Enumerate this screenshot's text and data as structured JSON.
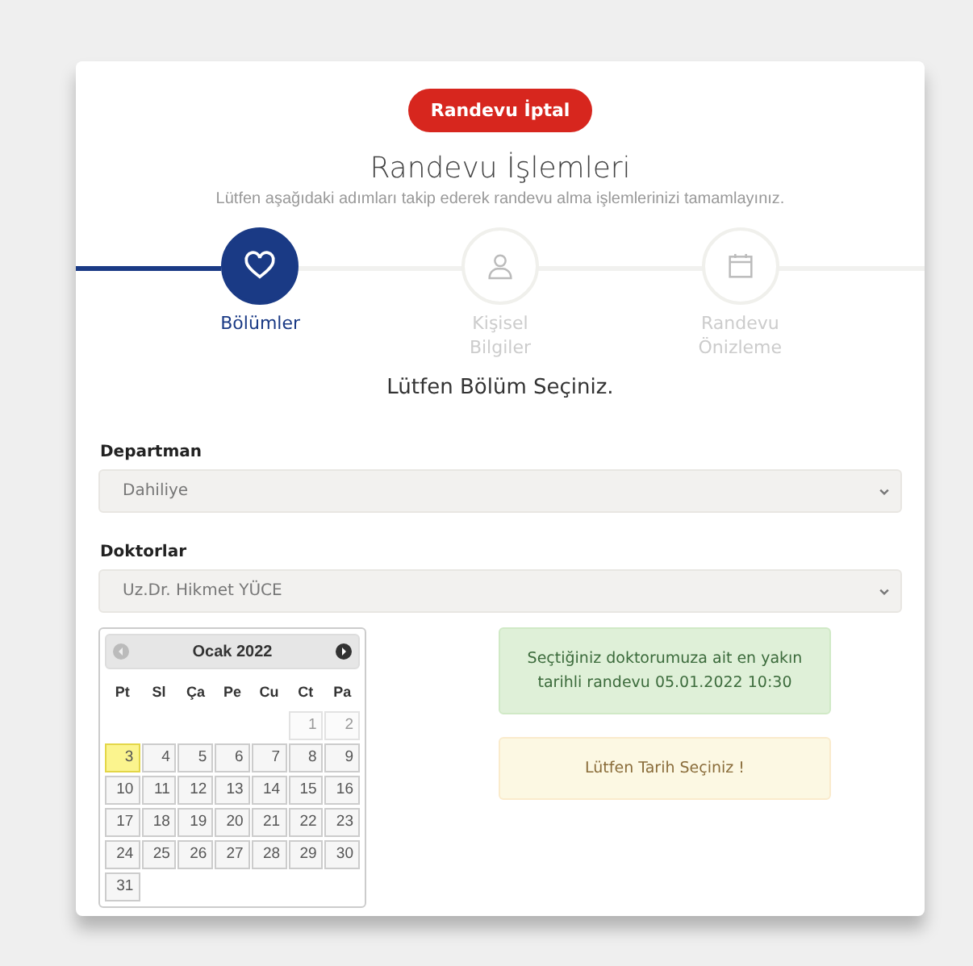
{
  "cancel_button": "Randevu İptal",
  "title": "Randevu İşlemleri",
  "subtitle": "Lütfen aşağıdaki adımları takip ederek randevu alma işlemlerinizi tamamlayınız.",
  "steps": [
    {
      "label": "Bölümler",
      "selected": true
    },
    {
      "label": "Kişisel Bilgiler",
      "selected": false
    },
    {
      "label": "Randevu Önizleme",
      "selected": false
    }
  ],
  "prompt": "Lütfen Bölüm Seçiniz.",
  "fields": [
    {
      "label": "Departman",
      "value": "Dahiliye"
    },
    {
      "label": "Doktorlar",
      "value": "Uz.Dr. Hikmet YÜCE"
    }
  ],
  "calendar": {
    "month": "Ocak 2022",
    "weekdays": [
      "Pt",
      "Sl",
      "Ça",
      "Pe",
      "Cu",
      "Ct",
      "Pa"
    ],
    "weeks": [
      [
        {
          "day": "1",
          "disabled": true,
          "selected": false
        },
        {
          "day": "2",
          "disabled": true,
          "selected": false
        }
      ],
      [
        {
          "day": "3",
          "disabled": false,
          "selected": true
        },
        {
          "day": "4",
          "disabled": false,
          "selected": false
        },
        {
          "day": "5",
          "disabled": false,
          "selected": false
        },
        {
          "day": "6",
          "disabled": false,
          "selected": false
        },
        {
          "day": "7",
          "disabled": false,
          "selected": false
        },
        {
          "day": "8",
          "disabled": false,
          "selected": false
        },
        {
          "day": "9",
          "disabled": false,
          "selected": false
        }
      ],
      [
        {
          "day": "10",
          "disabled": false,
          "selected": false
        },
        {
          "day": "11",
          "disabled": false,
          "selected": false
        },
        {
          "day": "12",
          "disabled": false,
          "selected": false
        },
        {
          "day": "13",
          "disabled": false,
          "selected": false
        },
        {
          "day": "14",
          "disabled": false,
          "selected": false
        },
        {
          "day": "15",
          "disabled": false,
          "selected": false
        },
        {
          "day": "16",
          "disabled": false,
          "selected": false
        }
      ],
      [
        {
          "day": "17",
          "disabled": false,
          "selected": false
        },
        {
          "day": "18",
          "disabled": false,
          "selected": false
        },
        {
          "day": "19",
          "disabled": false,
          "selected": false
        },
        {
          "day": "20",
          "disabled": false,
          "selected": false
        },
        {
          "day": "21",
          "disabled": false,
          "selected": false
        },
        {
          "day": "22",
          "disabled": false,
          "selected": false
        },
        {
          "day": "23",
          "disabled": false,
          "selected": false
        }
      ],
      [
        {
          "day": "24",
          "disabled": false,
          "selected": false
        },
        {
          "day": "25",
          "disabled": false,
          "selected": false
        },
        {
          "day": "26",
          "disabled": false,
          "selected": false
        },
        {
          "day": "27",
          "disabled": false,
          "selected": false
        },
        {
          "day": "28",
          "disabled": false,
          "selected": false
        },
        {
          "day": "29",
          "disabled": false,
          "selected": false
        },
        {
          "day": "30",
          "disabled": false,
          "selected": false
        }
      ],
      [
        {
          "day": "31",
          "disabled": false,
          "selected": false
        }
      ]
    ]
  },
  "alerts": [
    {
      "kind": "success",
      "text": "Seçtiğiniz doktorumuza ait en yakın tarihli randevu 05.01.2022  10:30"
    },
    {
      "kind": "warning",
      "text": "Lütfen Tarih Seçiniz !"
    }
  ]
}
